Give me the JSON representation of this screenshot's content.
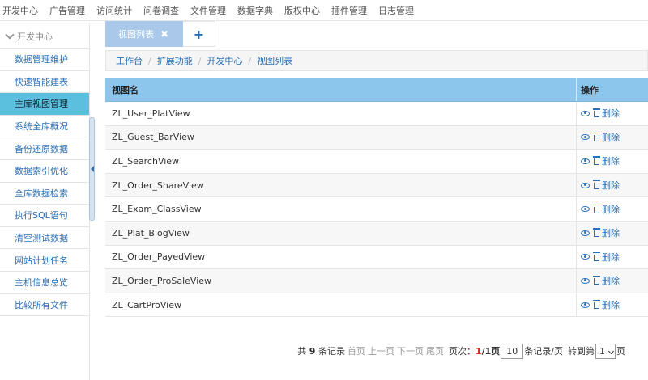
{
  "topnav": [
    "开发中心",
    "广告管理",
    "访问统计",
    "问卷调查",
    "文件管理",
    "数据字典",
    "版权中心",
    "插件管理",
    "日志管理"
  ],
  "sidebar": {
    "header": "开发中心",
    "items": [
      {
        "label": "数据管理维护",
        "active": false
      },
      {
        "label": "快速智能建表",
        "active": false
      },
      {
        "label": "主库视图管理",
        "active": true
      },
      {
        "label": "系统全库概况",
        "active": false
      },
      {
        "label": "备份还原数据",
        "active": false
      },
      {
        "label": "数据索引优化",
        "active": false
      },
      {
        "label": "全库数据检索",
        "active": false
      },
      {
        "label": "执行SQL语句",
        "active": false
      },
      {
        "label": "清空测试数据",
        "active": false
      },
      {
        "label": "网站计划任务",
        "active": false
      },
      {
        "label": "主机信息总览",
        "active": false
      },
      {
        "label": "比较所有文件",
        "active": false
      }
    ]
  },
  "tabs": {
    "current": "视图列表",
    "close": "✖",
    "add": "+"
  },
  "breadcrumb": [
    "工作台",
    "扩展功能",
    "开发中心",
    "视图列表"
  ],
  "table": {
    "headers": [
      "视图名",
      "操作"
    ],
    "delete_label": "删除",
    "rows": [
      "ZL_User_PlatView",
      "ZL_Guest_BarView",
      "ZL_SearchView",
      "ZL_Order_ShareView",
      "ZL_Exam_ClassView",
      "ZL_Plat_BlogView",
      "ZL_Order_PayedView",
      "ZL_Order_ProSaleView",
      "ZL_CartProView"
    ]
  },
  "pager": {
    "total_prefix": "共",
    "total": "9",
    "total_suffix": "条记录",
    "first": "首页",
    "prev": "上一页",
    "next": "下一页",
    "last": "尾页",
    "page_label": "页次：",
    "current_page": "1",
    "total_pages": "/1页",
    "page_size": "10",
    "page_size_suffix": "条记录/页",
    "goto_label": "转到第",
    "goto_value": "1",
    "goto_suffix": "页"
  },
  "colors": {
    "header_blue": "#8cc6ec",
    "active_item": "#5bc0de",
    "link_blue": "#2a6fb5",
    "tab_blue": "#a9c8ea"
  }
}
